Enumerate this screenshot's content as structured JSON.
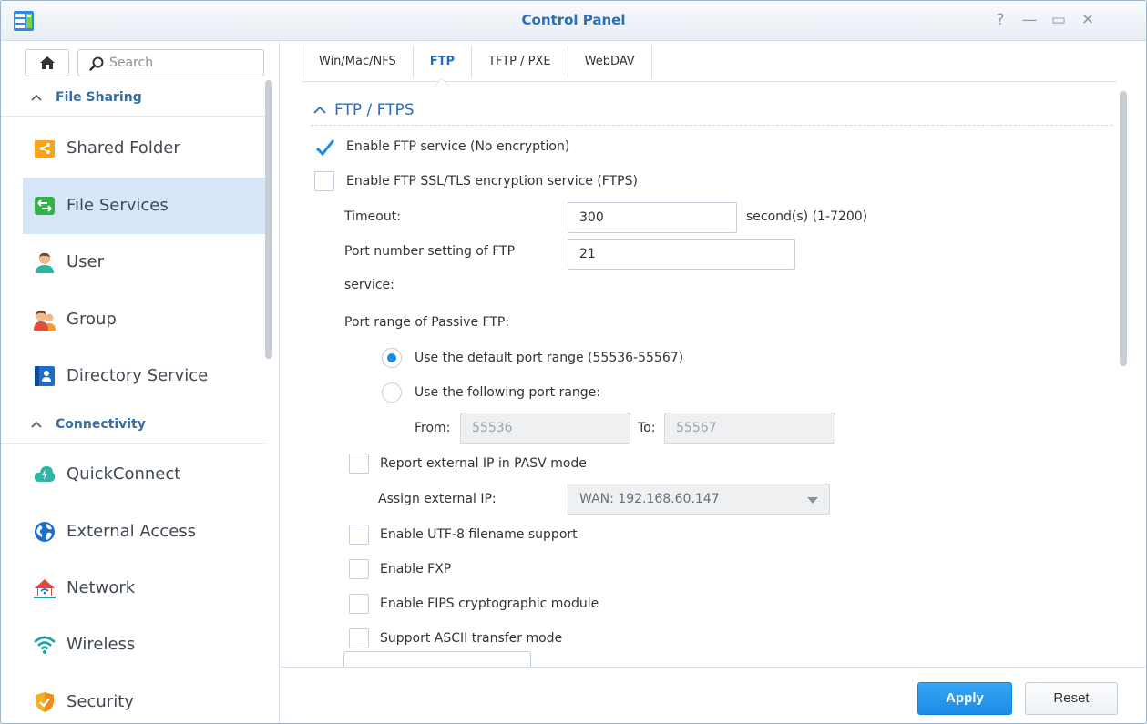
{
  "window": {
    "title": "Control Panel",
    "controls": {
      "help": "?",
      "minimize": "—",
      "maximize": "▭",
      "close": "✕"
    }
  },
  "sidebar": {
    "search_placeholder": "Search",
    "groups": [
      {
        "label": "File Sharing"
      },
      {
        "label": "Connectivity"
      }
    ],
    "items": [
      {
        "label": "Shared Folder",
        "icon": "shared-folder-icon"
      },
      {
        "label": "File Services",
        "icon": "file-services-icon",
        "active": true
      },
      {
        "label": "User",
        "icon": "user-icon"
      },
      {
        "label": "Group",
        "icon": "group-icon"
      },
      {
        "label": "Directory Service",
        "icon": "directory-service-icon"
      },
      {
        "label": "QuickConnect",
        "icon": "quickconnect-icon"
      },
      {
        "label": "External Access",
        "icon": "external-access-icon"
      },
      {
        "label": "Network",
        "icon": "network-icon"
      },
      {
        "label": "Wireless",
        "icon": "wireless-icon"
      },
      {
        "label": "Security",
        "icon": "security-icon"
      }
    ]
  },
  "tabs": [
    {
      "label": "Win/Mac/NFS"
    },
    {
      "label": "FTP",
      "active": true
    },
    {
      "label": "TFTP / PXE"
    },
    {
      "label": "WebDAV"
    }
  ],
  "ftp": {
    "section_title": "FTP / FTPS",
    "enable_ftp": {
      "label": "Enable FTP service (No encryption)",
      "checked": true
    },
    "enable_ftps": {
      "label": "Enable FTP SSL/TLS encryption service (FTPS)",
      "checked": false
    },
    "timeout": {
      "label": "Timeout:",
      "value": "300",
      "hint": "second(s) (1-7200)"
    },
    "port": {
      "label_line1": "Port number setting of FTP",
      "label_line2": "service:",
      "value": "21"
    },
    "passive": {
      "label": "Port range of Passive FTP:",
      "default_option": "Use the default port range (55536-55567)",
      "custom_option": "Use the following port range:",
      "from_label": "From:",
      "from_value": "55536",
      "to_label": "To:",
      "to_value": "55567"
    },
    "report_ip": {
      "label": "Report external IP in PASV mode",
      "checked": false
    },
    "assign_ip": {
      "label": "Assign external IP:",
      "value": "WAN: 192.168.60.147"
    },
    "utf8": {
      "label": "Enable UTF-8 filename support",
      "checked": false
    },
    "fxp": {
      "label": "Enable FXP",
      "checked": false
    },
    "fips": {
      "label": "Enable FIPS cryptographic module",
      "checked": false
    },
    "ascii": {
      "label": "Support ASCII transfer mode",
      "checked": false
    }
  },
  "footer": {
    "apply": "Apply",
    "reset": "Reset"
  },
  "colors": {
    "accent": "#1a8ce8",
    "title": "#2a6fb4",
    "active_item": "#d4e6f7"
  }
}
